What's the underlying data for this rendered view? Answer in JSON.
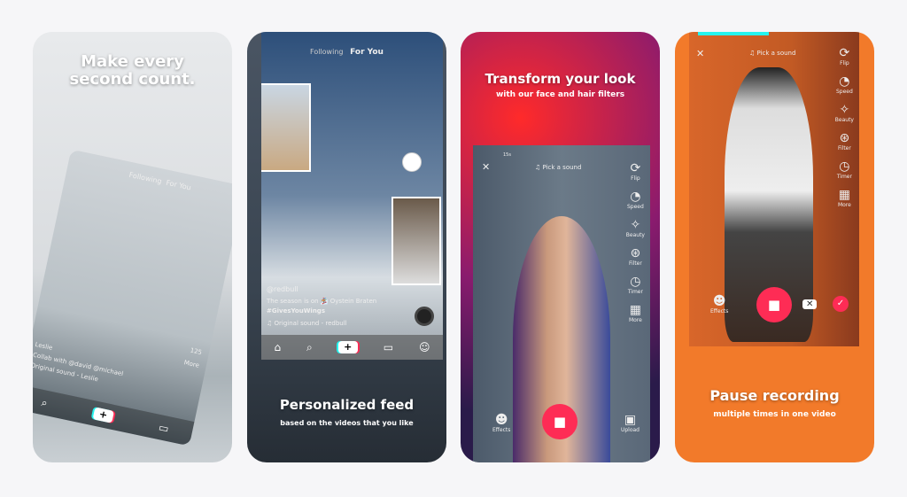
{
  "panels": [
    {
      "headline": "Make every second count.",
      "feed": {
        "following": "Following",
        "for_you": "For You",
        "username": "Leslie",
        "caption": "Collab with @david @michael",
        "sound": "Original sound - Leslie",
        "count": "125",
        "more": "More"
      }
    },
    {
      "headline": "Personalized feed",
      "subtitle": "based on the videos that you like",
      "feed": {
        "following": "Following",
        "for_you": "For You",
        "username": "@redbull",
        "caption": "The season is on 🏂 Oystein Braten",
        "hashtag": "#GivesYouWings",
        "sound": "Original sound - redbull"
      }
    },
    {
      "headline": "Transform your look",
      "subtitle": "with our face and hair filters",
      "camera": {
        "timer": "15s",
        "pick_sound": "Pick a sound",
        "tools": [
          "Flip",
          "Speed",
          "Beauty",
          "Filter",
          "Timer",
          "More"
        ],
        "effects": "Effects",
        "upload": "Upload"
      }
    },
    {
      "headline": "Pause recording",
      "subtitle": "multiple times in one video",
      "camera": {
        "pick_sound": "Pick a sound",
        "tools": [
          "Flip",
          "Speed",
          "Beauty",
          "Filter",
          "Timer",
          "More"
        ],
        "effects": "Effects"
      }
    }
  ],
  "colors": {
    "accent": "#fe2c55",
    "cyan": "#25f4ee",
    "orange": "#f27a2a"
  }
}
